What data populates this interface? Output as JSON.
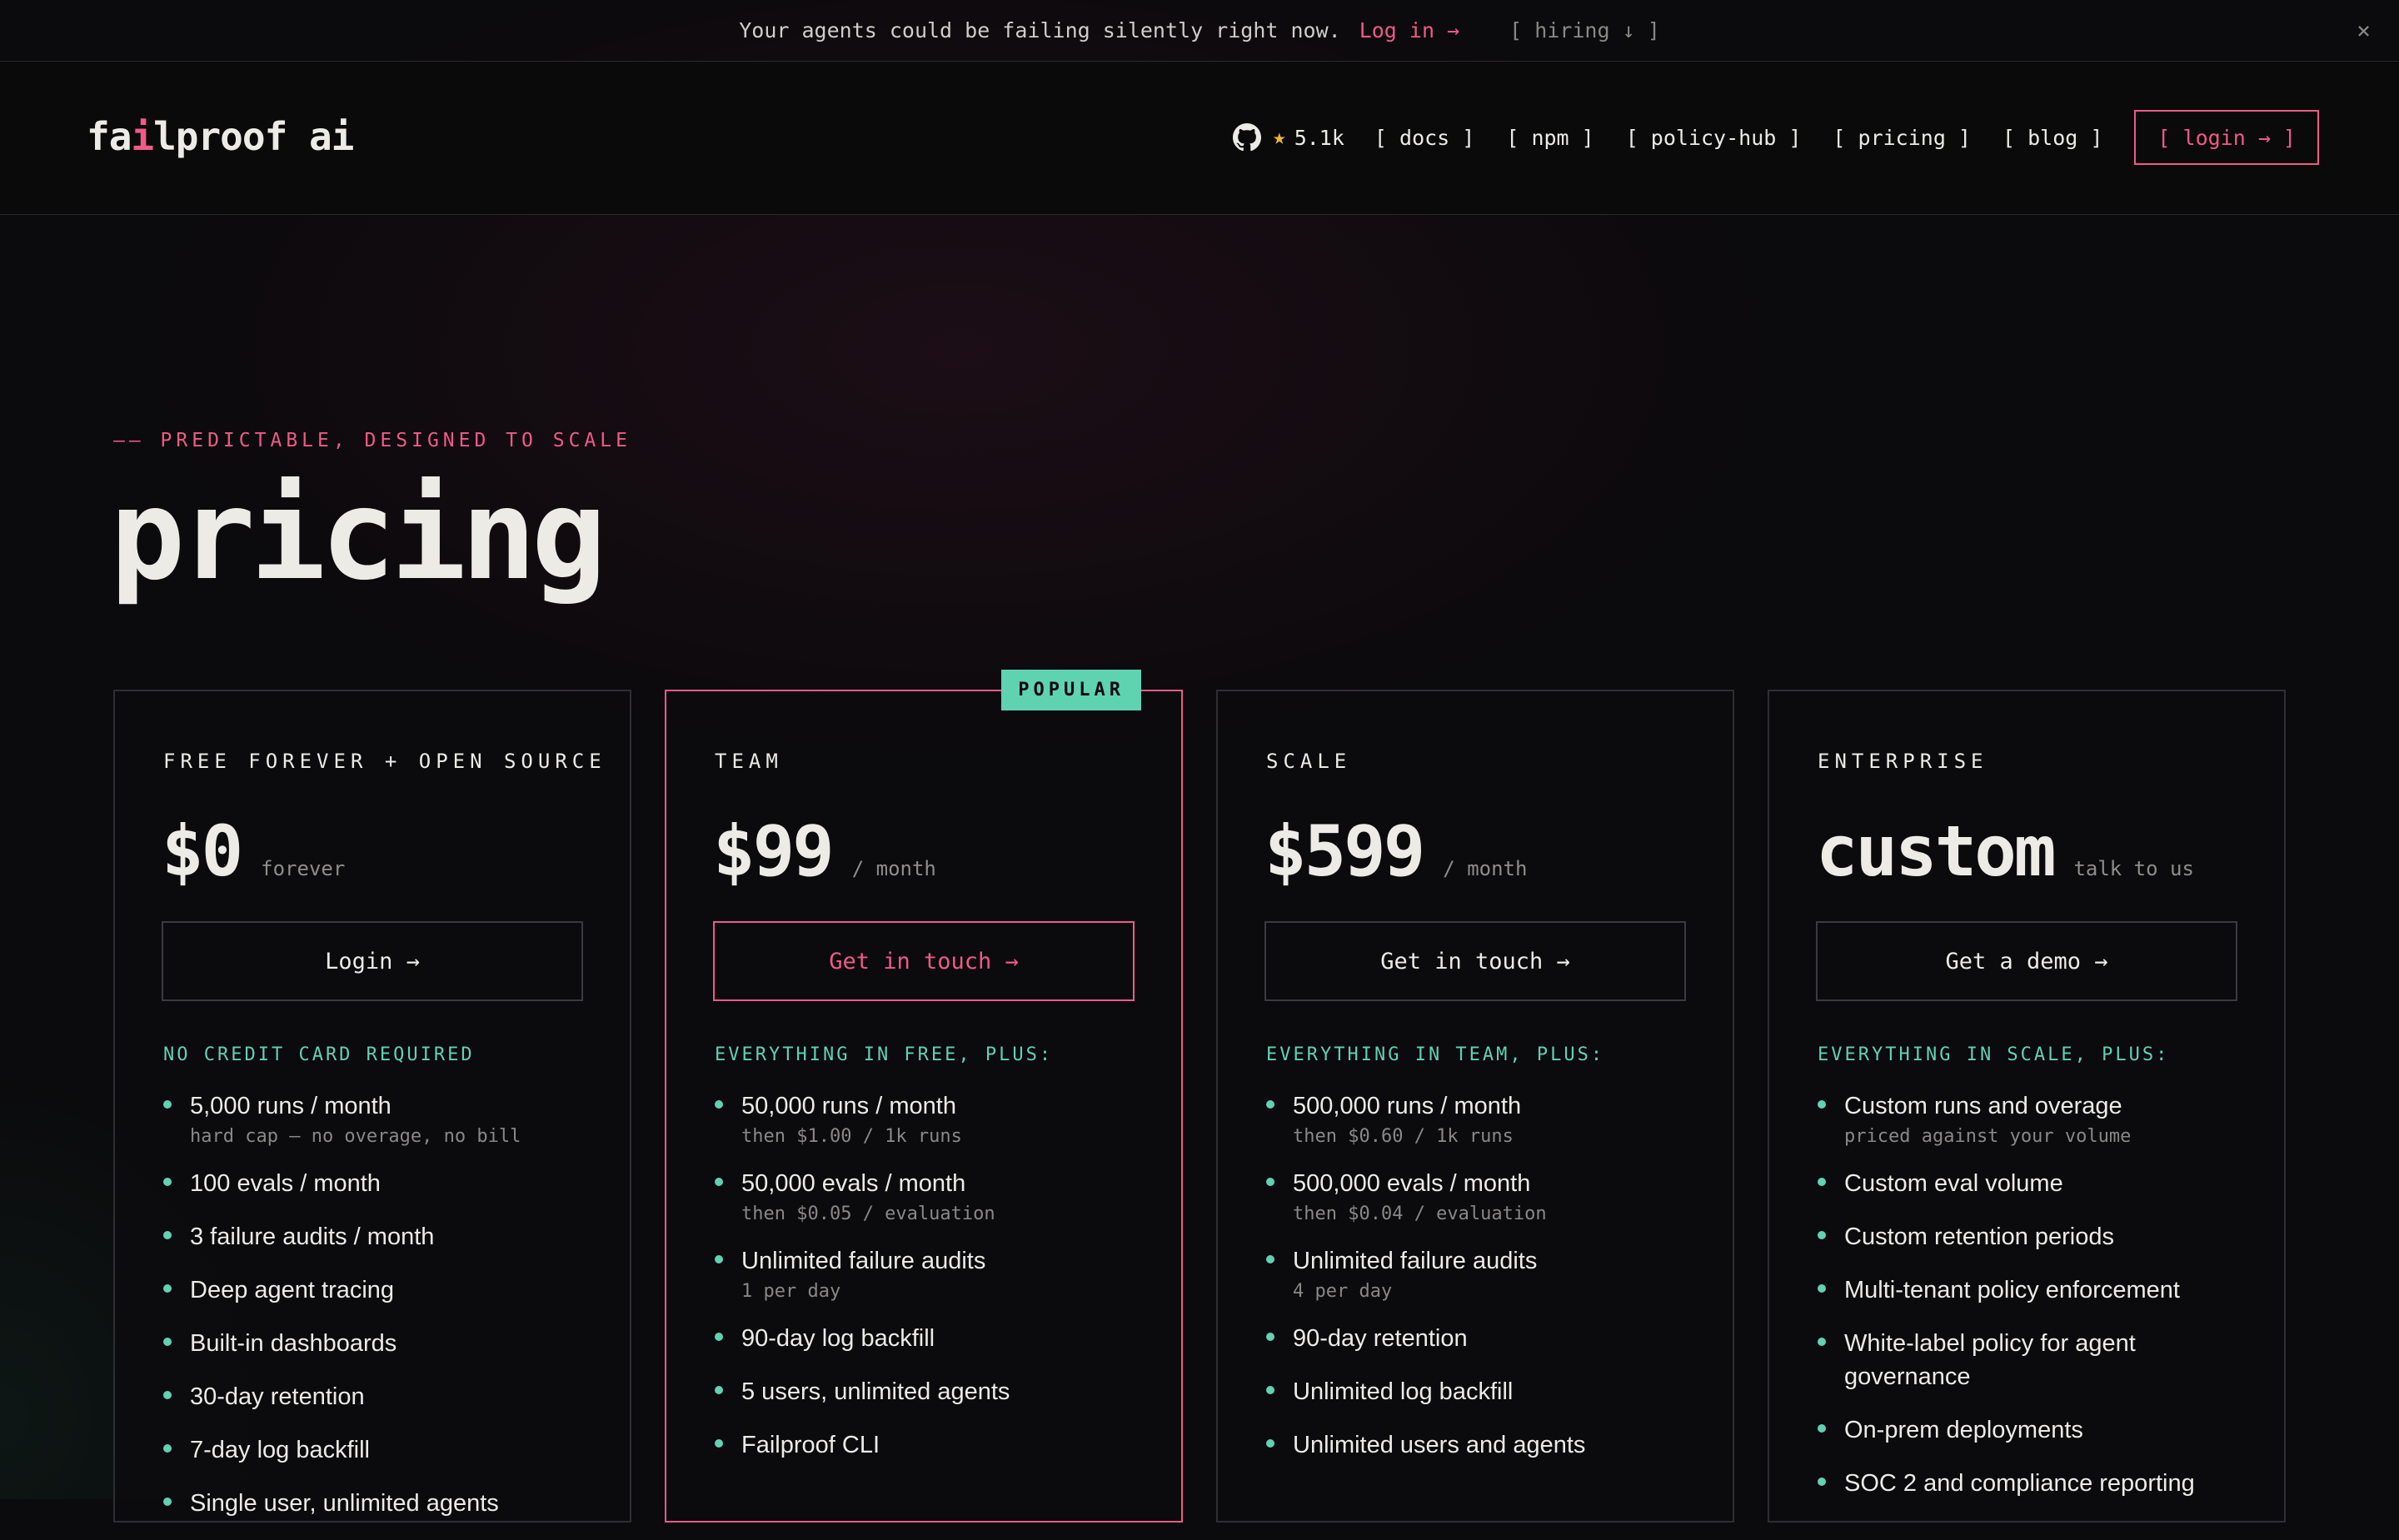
{
  "announcement": {
    "message": "Your agents could be failing silently right now.",
    "login_link": "Log in →",
    "hiring": "[ hiring ↓ ]",
    "close": "×"
  },
  "header": {
    "logo_pre": "fa",
    "logo_accent": "i",
    "logo_post": "lproof ai",
    "github_stars": "5.1k",
    "nav": [
      "[ docs ]",
      "[ npm ]",
      "[ policy-hub ]",
      "[ pricing ]",
      "[ blog ]"
    ],
    "login": "[ login → ]"
  },
  "hero": {
    "eyebrow": "—— PREDICTABLE, DESIGNED TO SCALE",
    "title": "pricing"
  },
  "cards": [
    {
      "tier": "FREE FOREVER + OPEN SOURCE",
      "price": "$0",
      "period": "forever",
      "cta": "Login →",
      "includes": "NO CREDIT CARD REQUIRED",
      "features": [
        {
          "main": "5,000 runs / month",
          "sub": "hard cap — no overage, no bill"
        },
        {
          "main": "100 evals / month",
          "sub": ""
        },
        {
          "main": "3 failure audits / month",
          "sub": ""
        },
        {
          "main": "Deep agent tracing",
          "sub": ""
        },
        {
          "main": "Built-in dashboards",
          "sub": ""
        },
        {
          "main": "30-day retention",
          "sub": ""
        },
        {
          "main": "7-day log backfill",
          "sub": ""
        },
        {
          "main": "Single user, unlimited agents",
          "sub": ""
        }
      ]
    },
    {
      "tier": "TEAM",
      "badge": "POPULAR",
      "price": "$99",
      "period": "/ month",
      "cta": "Get in touch →",
      "includes": "EVERYTHING IN FREE, PLUS:",
      "features": [
        {
          "main": "50,000 runs / month",
          "sub": "then $1.00 / 1k runs"
        },
        {
          "main": "50,000 evals / month",
          "sub": "then $0.05 / evaluation"
        },
        {
          "main": "Unlimited failure audits",
          "sub": "1 per day"
        },
        {
          "main": "90-day log backfill",
          "sub": ""
        },
        {
          "main": "5 users, unlimited agents",
          "sub": ""
        },
        {
          "main": "Failproof CLI",
          "sub": ""
        }
      ]
    },
    {
      "tier": "SCALE",
      "price": "$599",
      "period": "/ month",
      "cta": "Get in touch →",
      "includes": "EVERYTHING IN TEAM, PLUS:",
      "features": [
        {
          "main": "500,000 runs / month",
          "sub": "then $0.60 / 1k runs"
        },
        {
          "main": "500,000 evals / month",
          "sub": "then $0.04 / evaluation"
        },
        {
          "main": "Unlimited failure audits",
          "sub": "4 per day"
        },
        {
          "main": "90-day retention",
          "sub": ""
        },
        {
          "main": "Unlimited log backfill",
          "sub": ""
        },
        {
          "main": "Unlimited users and agents",
          "sub": ""
        }
      ]
    },
    {
      "tier": "ENTERPRISE",
      "price": "custom",
      "period": "talk to us",
      "cta": "Get a demo →",
      "includes": "EVERYTHING IN SCALE, PLUS:",
      "features": [
        {
          "main": "Custom runs and overage",
          "sub": "priced against your volume"
        },
        {
          "main": "Custom eval volume",
          "sub": ""
        },
        {
          "main": "Custom retention periods",
          "sub": ""
        },
        {
          "main": "Multi-tenant policy enforcement",
          "sub": ""
        },
        {
          "main": "White-label policy for agent governance",
          "sub": ""
        },
        {
          "main": "On-prem deployments",
          "sub": ""
        },
        {
          "main": "SOC 2 and compliance reporting",
          "sub": ""
        }
      ]
    }
  ]
}
